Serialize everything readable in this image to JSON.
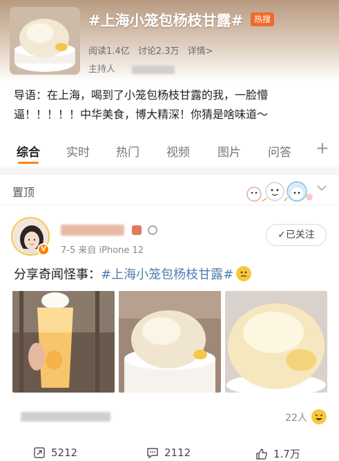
{
  "topic": {
    "title": "#上海小笼包杨枝甘露#",
    "hot_badge": "热搜",
    "reads": "阅读1.4亿",
    "discussions": "讨论2.3万",
    "details": "详情>",
    "host_label": "主持人"
  },
  "lead": {
    "text": "导语：在上海，喝到了小笼包杨枝甘露的我，一脸懵逼！！！！！中华美食，博大精深！你猜是啥味道～"
  },
  "tabs": [
    "综合",
    "实时",
    "热门",
    "视频",
    "图片",
    "问答"
  ],
  "pinned": {
    "label": "置顶"
  },
  "post": {
    "meta": "7-5  来自 iPhone 12",
    "follow_label": "✓已关注",
    "text_prefix": "分享奇闻怪事：",
    "text_topic": "#上海小笼包杨枝甘露#",
    "likes_summary": "22人"
  },
  "actions": {
    "reposts": "5212",
    "comments": "2112",
    "likes": "1.7万"
  },
  "colors": {
    "accent": "#ff8200",
    "topic_link": "#507daf",
    "hot_badge": "#f06a2b"
  }
}
